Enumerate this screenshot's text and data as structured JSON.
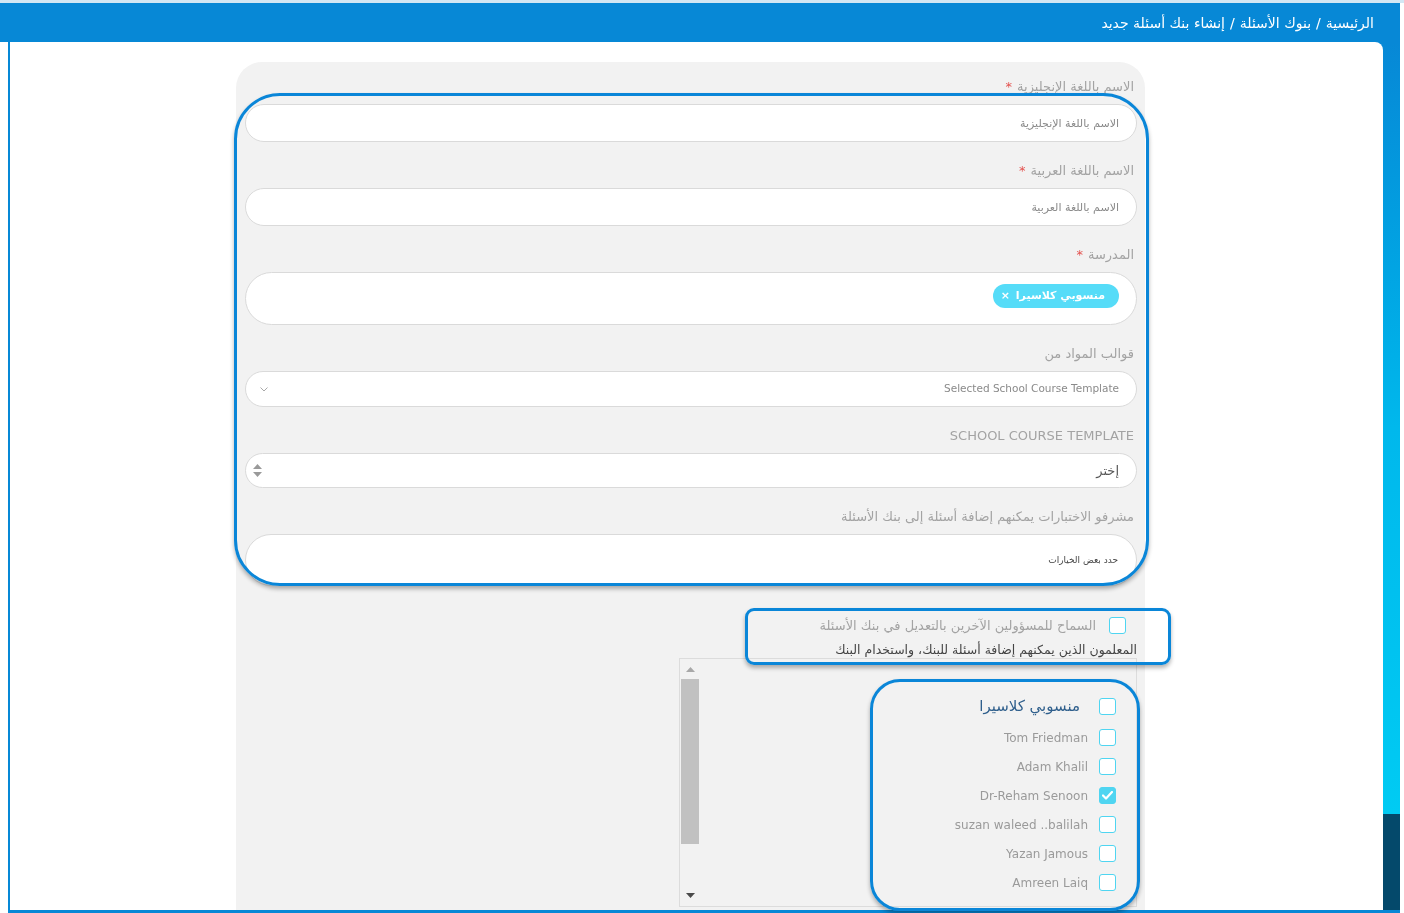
{
  "breadcrumb": {
    "separator": "/",
    "items": [
      {
        "label": "الرئيسية"
      },
      {
        "label": "بنوك الأسئلة"
      },
      {
        "label": "إنشاء بنك أسئلة جديد"
      }
    ]
  },
  "form": {
    "required_mark": "*",
    "fields": [
      {
        "kind": "text",
        "label": "الاسم باللغة الإنجليزية",
        "required": true,
        "placeholder": "الاسم باللغة الإنجليزية"
      },
      {
        "kind": "text",
        "label": "الاسم باللغة العربية",
        "required": true,
        "placeholder": "الاسم باللغة العربية"
      },
      {
        "kind": "tags",
        "label": "المدرسة",
        "required": true,
        "tags": [
          {
            "label": "منسوبي كلاسيرا",
            "remove": "×"
          }
        ]
      },
      {
        "kind": "dropdown",
        "label": "قوالب المواد من",
        "required": false,
        "placeholder": "Selected School Course Template"
      },
      {
        "kind": "select",
        "label": "SCHOOL COURSE TEMPLATE",
        "required": false,
        "value": "إختر"
      },
      {
        "kind": "multiselect",
        "label": "مشرفو الاختبارات يمكنهم إضافة أسئلة إلى بنك الأسئلة",
        "required": false,
        "placeholder": "حدد بعض الخيارات"
      }
    ],
    "allow_edit": {
      "label": "السماح للمسؤولين الآخرين بالتعديل في بنك الأسئلة",
      "checked": false
    },
    "teachers": {
      "label": "المعلمون الذين يمكنهم إضافة أسئلة للبنك، واستخدام البنك",
      "groups": [
        {
          "label": "منسوبي كلاسيرا",
          "checked": false,
          "children": [
            {
              "label": "Tom Friedman",
              "checked": false
            },
            {
              "label": "Adam Khalil",
              "checked": false
            },
            {
              "label": "Dr-Reham Senoon",
              "checked": true
            },
            {
              "label": "suzan waleed ..balilah",
              "checked": false
            },
            {
              "label": "Yazan Jamous",
              "checked": false
            },
            {
              "label": "Amreen Laiq",
              "checked": false
            }
          ]
        }
      ]
    }
  }
}
